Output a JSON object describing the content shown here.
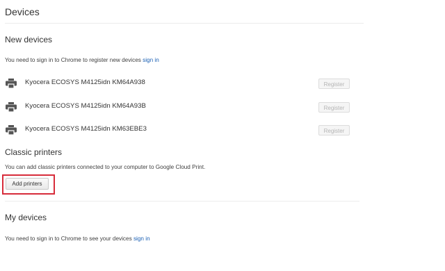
{
  "page": {
    "title": "Devices"
  },
  "new_devices": {
    "heading": "New devices",
    "note": "You need to sign in to Chrome to register new devices",
    "note_link": "sign in",
    "printers": [
      {
        "name": "Kyocera ECOSYS M4125idn KM64A938",
        "button_label": "Register",
        "icon": "printer-icon"
      },
      {
        "name": "Kyocera ECOSYS M4125idn KM64A93B",
        "button_label": "Register",
        "icon": "printer-icon"
      },
      {
        "name": "Kyocera ECOSYS M4125idn KM63EBE3",
        "button_label": "Register",
        "icon": "printer-icon"
      }
    ]
  },
  "classic_printers": {
    "heading": "Classic printers",
    "note": "You can add classic printers connected to your computer to Google Cloud Print.",
    "button_label": "Add printers"
  },
  "my_devices": {
    "heading": "My devices",
    "note": "You need to sign in to Chrome to see your devices",
    "note_link": "sign in"
  },
  "colors": {
    "link": "#1a5fb4",
    "highlight": "#d72c3a",
    "divider": "#ececec"
  }
}
